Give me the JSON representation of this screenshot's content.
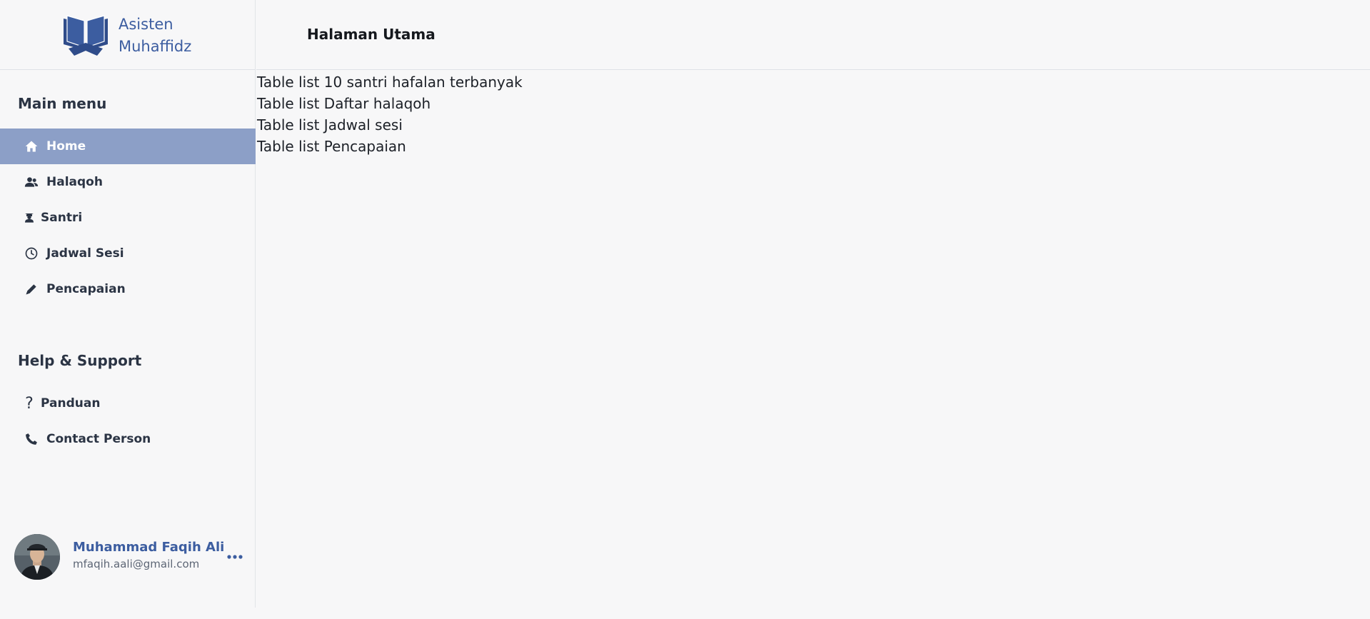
{
  "brand": {
    "line1": "Asisten",
    "line2": "Muhaffidz"
  },
  "sidebar": {
    "main_menu_title": "Main menu",
    "main_items": [
      {
        "label": "Home",
        "icon": "home-icon",
        "active": true
      },
      {
        "label": "Halaqoh",
        "icon": "users-icon",
        "active": false
      },
      {
        "label": "Santri",
        "icon": "student-icon",
        "active": false
      },
      {
        "label": "Jadwal Sesi",
        "icon": "clock-icon",
        "active": false
      },
      {
        "label": "Pencapaian",
        "icon": "pencil-icon",
        "active": false
      }
    ],
    "help_title": "Help & Support",
    "help_items": [
      {
        "label": "Panduan",
        "icon": "question-icon"
      },
      {
        "label": "Contact Person",
        "icon": "phone-icon"
      }
    ]
  },
  "profile": {
    "name": "Muhammad Faqih Ali",
    "email": "mfaqih.aali@gmail.com"
  },
  "header": {
    "title": "Halaman Utama"
  },
  "main": {
    "lines": [
      "Table list 10 santri hafalan terbanyak",
      "Table list Daftar halaqoh",
      "Table list Jadwal sesi",
      "Table list Pencapaian"
    ]
  },
  "colors": {
    "accent": "#3c5da0",
    "active_bg": "#8c9fc7",
    "text": "#2b3444"
  }
}
